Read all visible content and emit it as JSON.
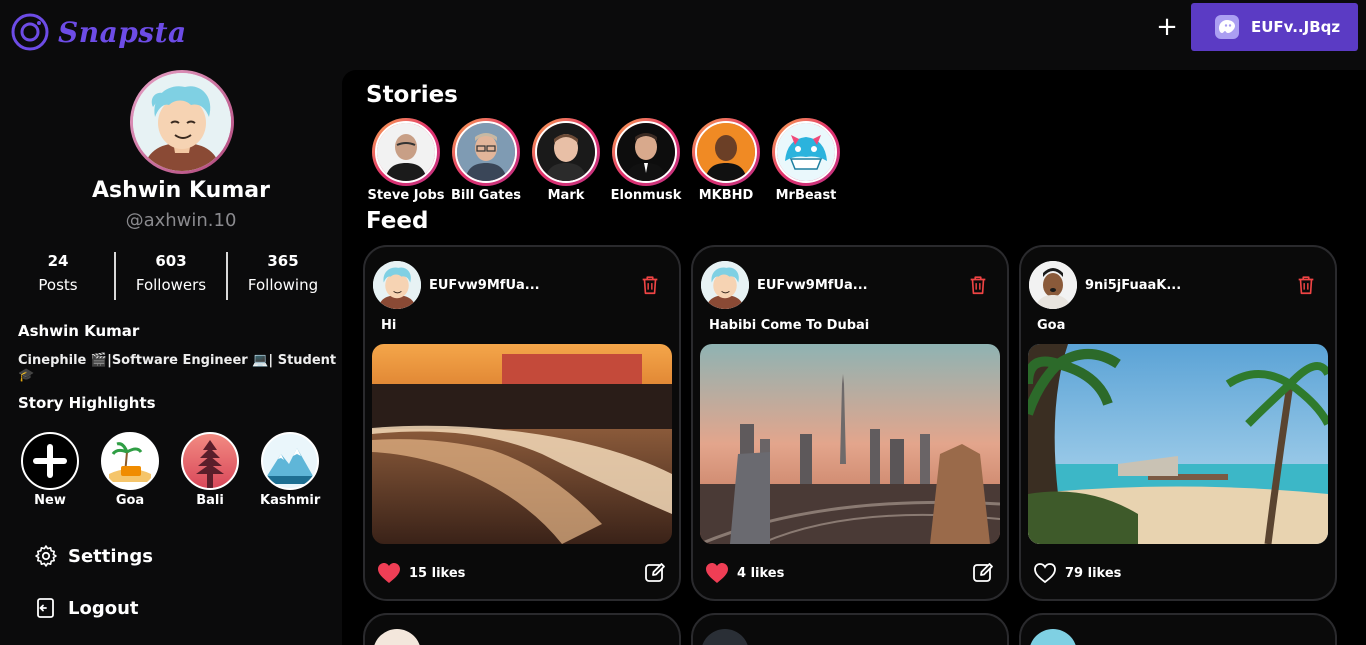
{
  "app": {
    "name": "Snapsta"
  },
  "header": {
    "new_post_symbol": "+",
    "wallet_label": "EUFv..JBqz",
    "wallet_icon": "ghost-icon"
  },
  "profile": {
    "name": "Ashwin Kumar",
    "handle": "@axhwin.10",
    "stats": [
      {
        "value": "24",
        "label": "Posts"
      },
      {
        "value": "603",
        "label": "Followers"
      },
      {
        "value": "365",
        "label": "Following"
      }
    ],
    "bio_name": "Ashwin Kumar",
    "bio": "Cinephile 🎬|Software Engineer 💻| Student 🎓",
    "highlights_title": "Story Highlights",
    "highlights": [
      {
        "label": "New"
      },
      {
        "label": "Goa"
      },
      {
        "label": "Bali"
      },
      {
        "label": "Kashmir"
      }
    ]
  },
  "menu": {
    "settings": "Settings",
    "logout": "Logout"
  },
  "stories_title": "Stories",
  "stories": [
    {
      "label": "Steve Jobs"
    },
    {
      "label": "Bill Gates"
    },
    {
      "label": "Mark"
    },
    {
      "label": "Elonmusk"
    },
    {
      "label": "MKBHD"
    },
    {
      "label": "MrBeast"
    }
  ],
  "feed_title": "Feed",
  "posts": [
    {
      "user": "EUFvw9MfUa...",
      "caption": "Hi",
      "likes": "15 likes",
      "liked": true
    },
    {
      "user": "EUFvw9MfUa...",
      "caption": "Habibi Come To Dubai",
      "likes": "4 likes",
      "liked": true
    },
    {
      "user": "9ni5jFuaaK...",
      "caption": "Goa",
      "likes": "79 likes",
      "liked": false
    }
  ],
  "colors": {
    "accent": "#5b3bc4",
    "logo": "#6d4ce6",
    "like": "#ef3e55",
    "trash": "#ef4444"
  }
}
